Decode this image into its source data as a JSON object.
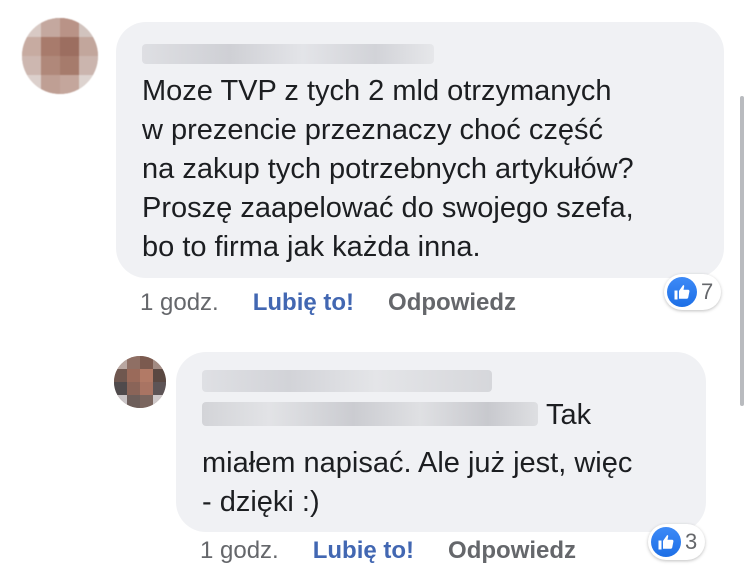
{
  "comments": [
    {
      "text": "Moze TVP z tych 2 mld otrzymanych\nw prezencie przeznaczy choć część\nna zakup tych potrzebnych artykułów?\nProszę  zaapelować do swojego szefa,\nbo to firma jak każda inna.",
      "time": "1 godz.",
      "like_label": "Lubię to!",
      "reply_label": "Odpowiedz",
      "reaction_count": "7",
      "reaction_icon": "thumbs-up-icon"
    },
    {
      "text_first_line_tail": "Tak",
      "text": "miałem napisać. Ale już jest, więc\n- dzięki :)",
      "time": "1 godz.",
      "like_label": "Lubię to!",
      "reply_label": "Odpowiedz",
      "reaction_count": "3",
      "reaction_icon": "thumbs-up-icon"
    }
  ],
  "colors": {
    "bubble": "#f0f1f4",
    "like_link": "#4267b2",
    "meta_text": "#65676b",
    "like_badge": "#1d6fe6"
  }
}
